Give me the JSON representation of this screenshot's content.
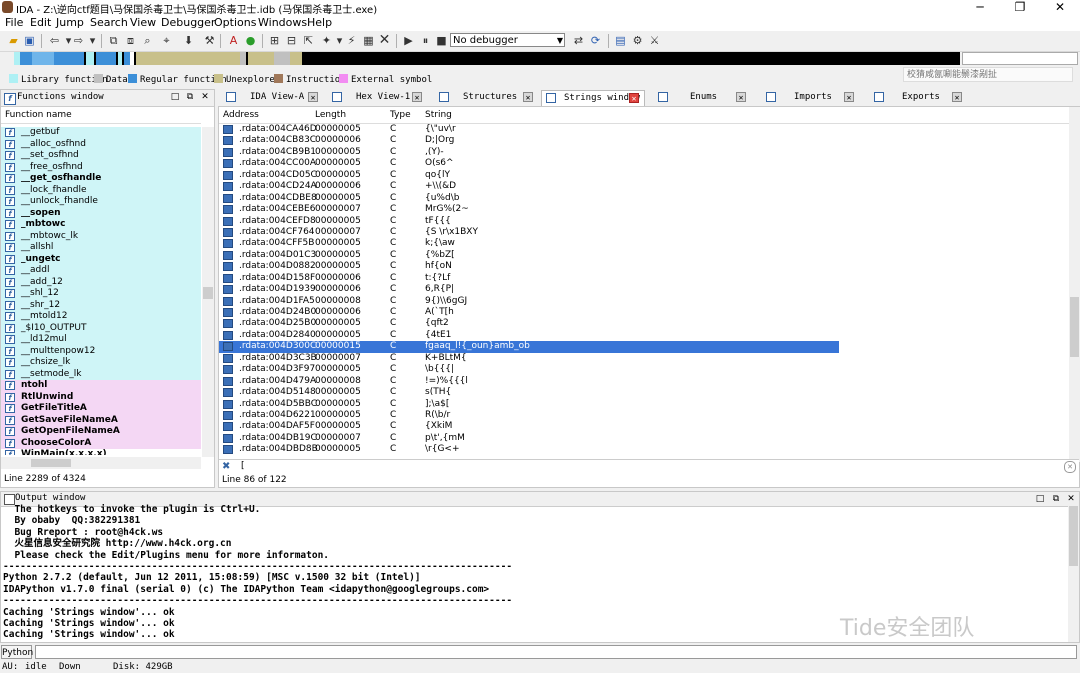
{
  "window": {
    "title": "IDA - Z:\\逆向ctf题目\\马保国杀毒卫士\\马保国杀毒卫士.idb (马保国杀毒卫士.exe)",
    "buttons": [
      "─",
      "❐",
      "✕"
    ]
  },
  "menu": [
    "File",
    "Edit",
    "Jump",
    "Search",
    "View",
    "Debugger",
    "Options",
    "Windows",
    "Help"
  ],
  "toolbar": {
    "debugger_select": "No debugger"
  },
  "legend": [
    {
      "label": "Library function",
      "color": "#aef0f4"
    },
    {
      "label": "Data",
      "color": "#c0c0c0"
    },
    {
      "label": "Regular function",
      "color": "#3c8fd8"
    },
    {
      "label": "Unexplored",
      "color": "#c8c08a"
    },
    {
      "label": "Instruction",
      "color": "#a0785a"
    },
    {
      "label": "External symbol",
      "color": "#f28cf2"
    }
  ],
  "hint": "校猜咸氤唰能鬃漆剐扯",
  "functions_window": {
    "title": "Functions window",
    "column": "Function name",
    "items": [
      {
        "name": "__getbuf",
        "style": "normal",
        "bold": false
      },
      {
        "name": "__alloc_osfhnd",
        "style": "normal",
        "bold": false
      },
      {
        "name": "__set_osfhnd",
        "style": "normal",
        "bold": false
      },
      {
        "name": "__free_osfhnd",
        "style": "normal",
        "bold": false
      },
      {
        "name": "__get_osfhandle",
        "style": "normal",
        "bold": true
      },
      {
        "name": "__lock_fhandle",
        "style": "normal",
        "bold": false
      },
      {
        "name": "__unlock_fhandle",
        "style": "normal",
        "bold": false
      },
      {
        "name": "__sopen",
        "style": "normal",
        "bold": true
      },
      {
        "name": "_mbtowc",
        "style": "normal",
        "bold": true
      },
      {
        "name": "__mbtowc_lk",
        "style": "normal",
        "bold": false
      },
      {
        "name": "__allshl",
        "style": "normal",
        "bold": false
      },
      {
        "name": "_ungetc",
        "style": "normal",
        "bold": true
      },
      {
        "name": "__addl",
        "style": "normal",
        "bold": false
      },
      {
        "name": "__add_12",
        "style": "normal",
        "bold": false
      },
      {
        "name": "__shl_12",
        "style": "normal",
        "bold": false
      },
      {
        "name": "__shr_12",
        "style": "normal",
        "bold": false
      },
      {
        "name": "__mtold12",
        "style": "normal",
        "bold": false
      },
      {
        "name": "_$I10_OUTPUT",
        "style": "normal",
        "bold": false
      },
      {
        "name": "__ld12mul",
        "style": "normal",
        "bold": false
      },
      {
        "name": "__multtenpow12",
        "style": "normal",
        "bold": false
      },
      {
        "name": "__chsize_lk",
        "style": "normal",
        "bold": false
      },
      {
        "name": "__setmode_lk",
        "style": "normal",
        "bold": false
      },
      {
        "name": "ntohl",
        "style": "ext",
        "bold": true
      },
      {
        "name": "RtlUnwind",
        "style": "ext",
        "bold": true
      },
      {
        "name": "GetFileTitleA",
        "style": "ext",
        "bold": true
      },
      {
        "name": "GetSaveFileNameA",
        "style": "ext",
        "bold": true
      },
      {
        "name": "GetOpenFileNameA",
        "style": "ext",
        "bold": true
      },
      {
        "name": "ChooseColorA",
        "style": "ext",
        "bold": true
      },
      {
        "name": "WinMain(x,x,x,x)",
        "style": "plain",
        "bold": true
      }
    ],
    "status": "Line 2289 of 4324"
  },
  "tabs": [
    {
      "label": "IDA View-A",
      "active": false
    },
    {
      "label": "Hex View-1",
      "active": false
    },
    {
      "label": "Structures",
      "active": false
    },
    {
      "label": "Strings window",
      "active": true
    },
    {
      "label": "Enums",
      "active": false
    },
    {
      "label": "Imports",
      "active": false
    },
    {
      "label": "Exports",
      "active": false
    }
  ],
  "strings_window": {
    "columns": [
      "Address",
      "Length",
      "Type",
      "String"
    ],
    "rows": [
      {
        "address": ".rdata:004CA46D",
        "length": "00000005",
        "type": "C",
        "string": "{\\\"uv\\r"
      },
      {
        "address": ".rdata:004CB83C",
        "length": "00000006",
        "type": "C",
        "string": "D;|Org"
      },
      {
        "address": ".rdata:004CB9B1",
        "length": "00000005",
        "type": "C",
        "string": ",(Y)-"
      },
      {
        "address": ".rdata:004CC00A",
        "length": "00000005",
        "type": "C",
        "string": "O(s6^"
      },
      {
        "address": ".rdata:004CD05C",
        "length": "00000005",
        "type": "C",
        "string": "qo{lY"
      },
      {
        "address": ".rdata:004CD24A",
        "length": "00000006",
        "type": "C",
        "string": "+\\\\(&D"
      },
      {
        "address": ".rdata:004CDBE8",
        "length": "00000005",
        "type": "C",
        "string": "{u%d\\b"
      },
      {
        "address": ".rdata:004CEBE6",
        "length": "00000007",
        "type": "C",
        "string": "MrG%(2~"
      },
      {
        "address": ".rdata:004CEFD8",
        "length": "00000005",
        "type": "C",
        "string": "tF{{{"
      },
      {
        "address": ".rdata:004CF764",
        "length": "00000007",
        "type": "C",
        "string": "{S \\r\\x1BXY"
      },
      {
        "address": ".rdata:004CFF5B",
        "length": "00000005",
        "type": "C",
        "string": "k;{\\aw"
      },
      {
        "address": ".rdata:004D01C3",
        "length": "00000005",
        "type": "C",
        "string": "{%bZ["
      },
      {
        "address": ".rdata:004D0882",
        "length": "00000005",
        "type": "C",
        "string": "hf{oN"
      },
      {
        "address": ".rdata:004D158F",
        "length": "00000006",
        "type": "C",
        "string": "t:{?Lf"
      },
      {
        "address": ".rdata:004D1939",
        "length": "00000006",
        "type": "C",
        "string": "6,R{P|"
      },
      {
        "address": ".rdata:004D1FA5",
        "length": "00000008",
        "type": "C",
        "string": "9{)\\\\6gGJ"
      },
      {
        "address": ".rdata:004D24B0",
        "length": "00000006",
        "type": "C",
        "string": "A(`T[h"
      },
      {
        "address": ".rdata:004D25B0",
        "length": "00000005",
        "type": "C",
        "string": "{qft2"
      },
      {
        "address": ".rdata:004D2840",
        "length": "00000005",
        "type": "C",
        "string": "{4tE1"
      },
      {
        "address": ".rdata:004D300C",
        "length": "00000015",
        "type": "C",
        "string": "fgaaq_l!{_oun}amb_ob",
        "selected": true
      },
      {
        "address": ".rdata:004D3C3B",
        "length": "00000007",
        "type": "C",
        "string": "K+BLtM{"
      },
      {
        "address": ".rdata:004D3F97",
        "length": "00000005",
        "type": "C",
        "string": "\\b{{{|"
      },
      {
        "address": ".rdata:004D479A",
        "length": "00000008",
        "type": "C",
        "string": "!=)%{{{l"
      },
      {
        "address": ".rdata:004D5148",
        "length": "00000005",
        "type": "C",
        "string": "s(TH{"
      },
      {
        "address": ".rdata:004D5BBC",
        "length": "00000005",
        "type": "C",
        "string": "];\\a$["
      },
      {
        "address": ".rdata:004D6221",
        "length": "00000005",
        "type": "C",
        "string": "R(\\b/r"
      },
      {
        "address": ".rdata:004DAF5F",
        "length": "00000005",
        "type": "C",
        "string": "{XkiM"
      },
      {
        "address": ".rdata:004DB19C",
        "length": "00000007",
        "type": "C",
        "string": "p\\t',{mM"
      },
      {
        "address": ".rdata:004DBD8B",
        "length": "00000005",
        "type": "C",
        "string": "\\r{G<+"
      }
    ],
    "filter": "[",
    "status": "Line 86 of 122"
  },
  "output_window": {
    "title": "Output window",
    "text": "  The hotkeys to invoke the plugin is Ctrl+U.\n  By obaby  QQ:382291381\n  Bug Rreport : root@h4ck.ws\n  火星信息安全研究院 http://www.h4ck.org.cn\n  Please check the Edit/Plugins menu for more informaton.\n-----------------------------------------------------------------------------------------\nPython 2.7.2 (default, Jun 12 2011, 15:08:59) [MSC v.1500 32 bit (Intel)]\nIDAPython v1.7.0 final (serial 0) (c) The IDAPython Team <idapython@googlegroups.com>\n-----------------------------------------------------------------------------------------\nCaching 'Strings window'... ok\nCaching 'Strings window'... ok\nCaching 'Strings window'... ok"
  },
  "watermark": "Tide安全团队",
  "python_button": "Python",
  "statusbar": {
    "au_label": "AU:",
    "au_state": "idle",
    "direction": "Down",
    "disk": "Disk: 429GB"
  }
}
